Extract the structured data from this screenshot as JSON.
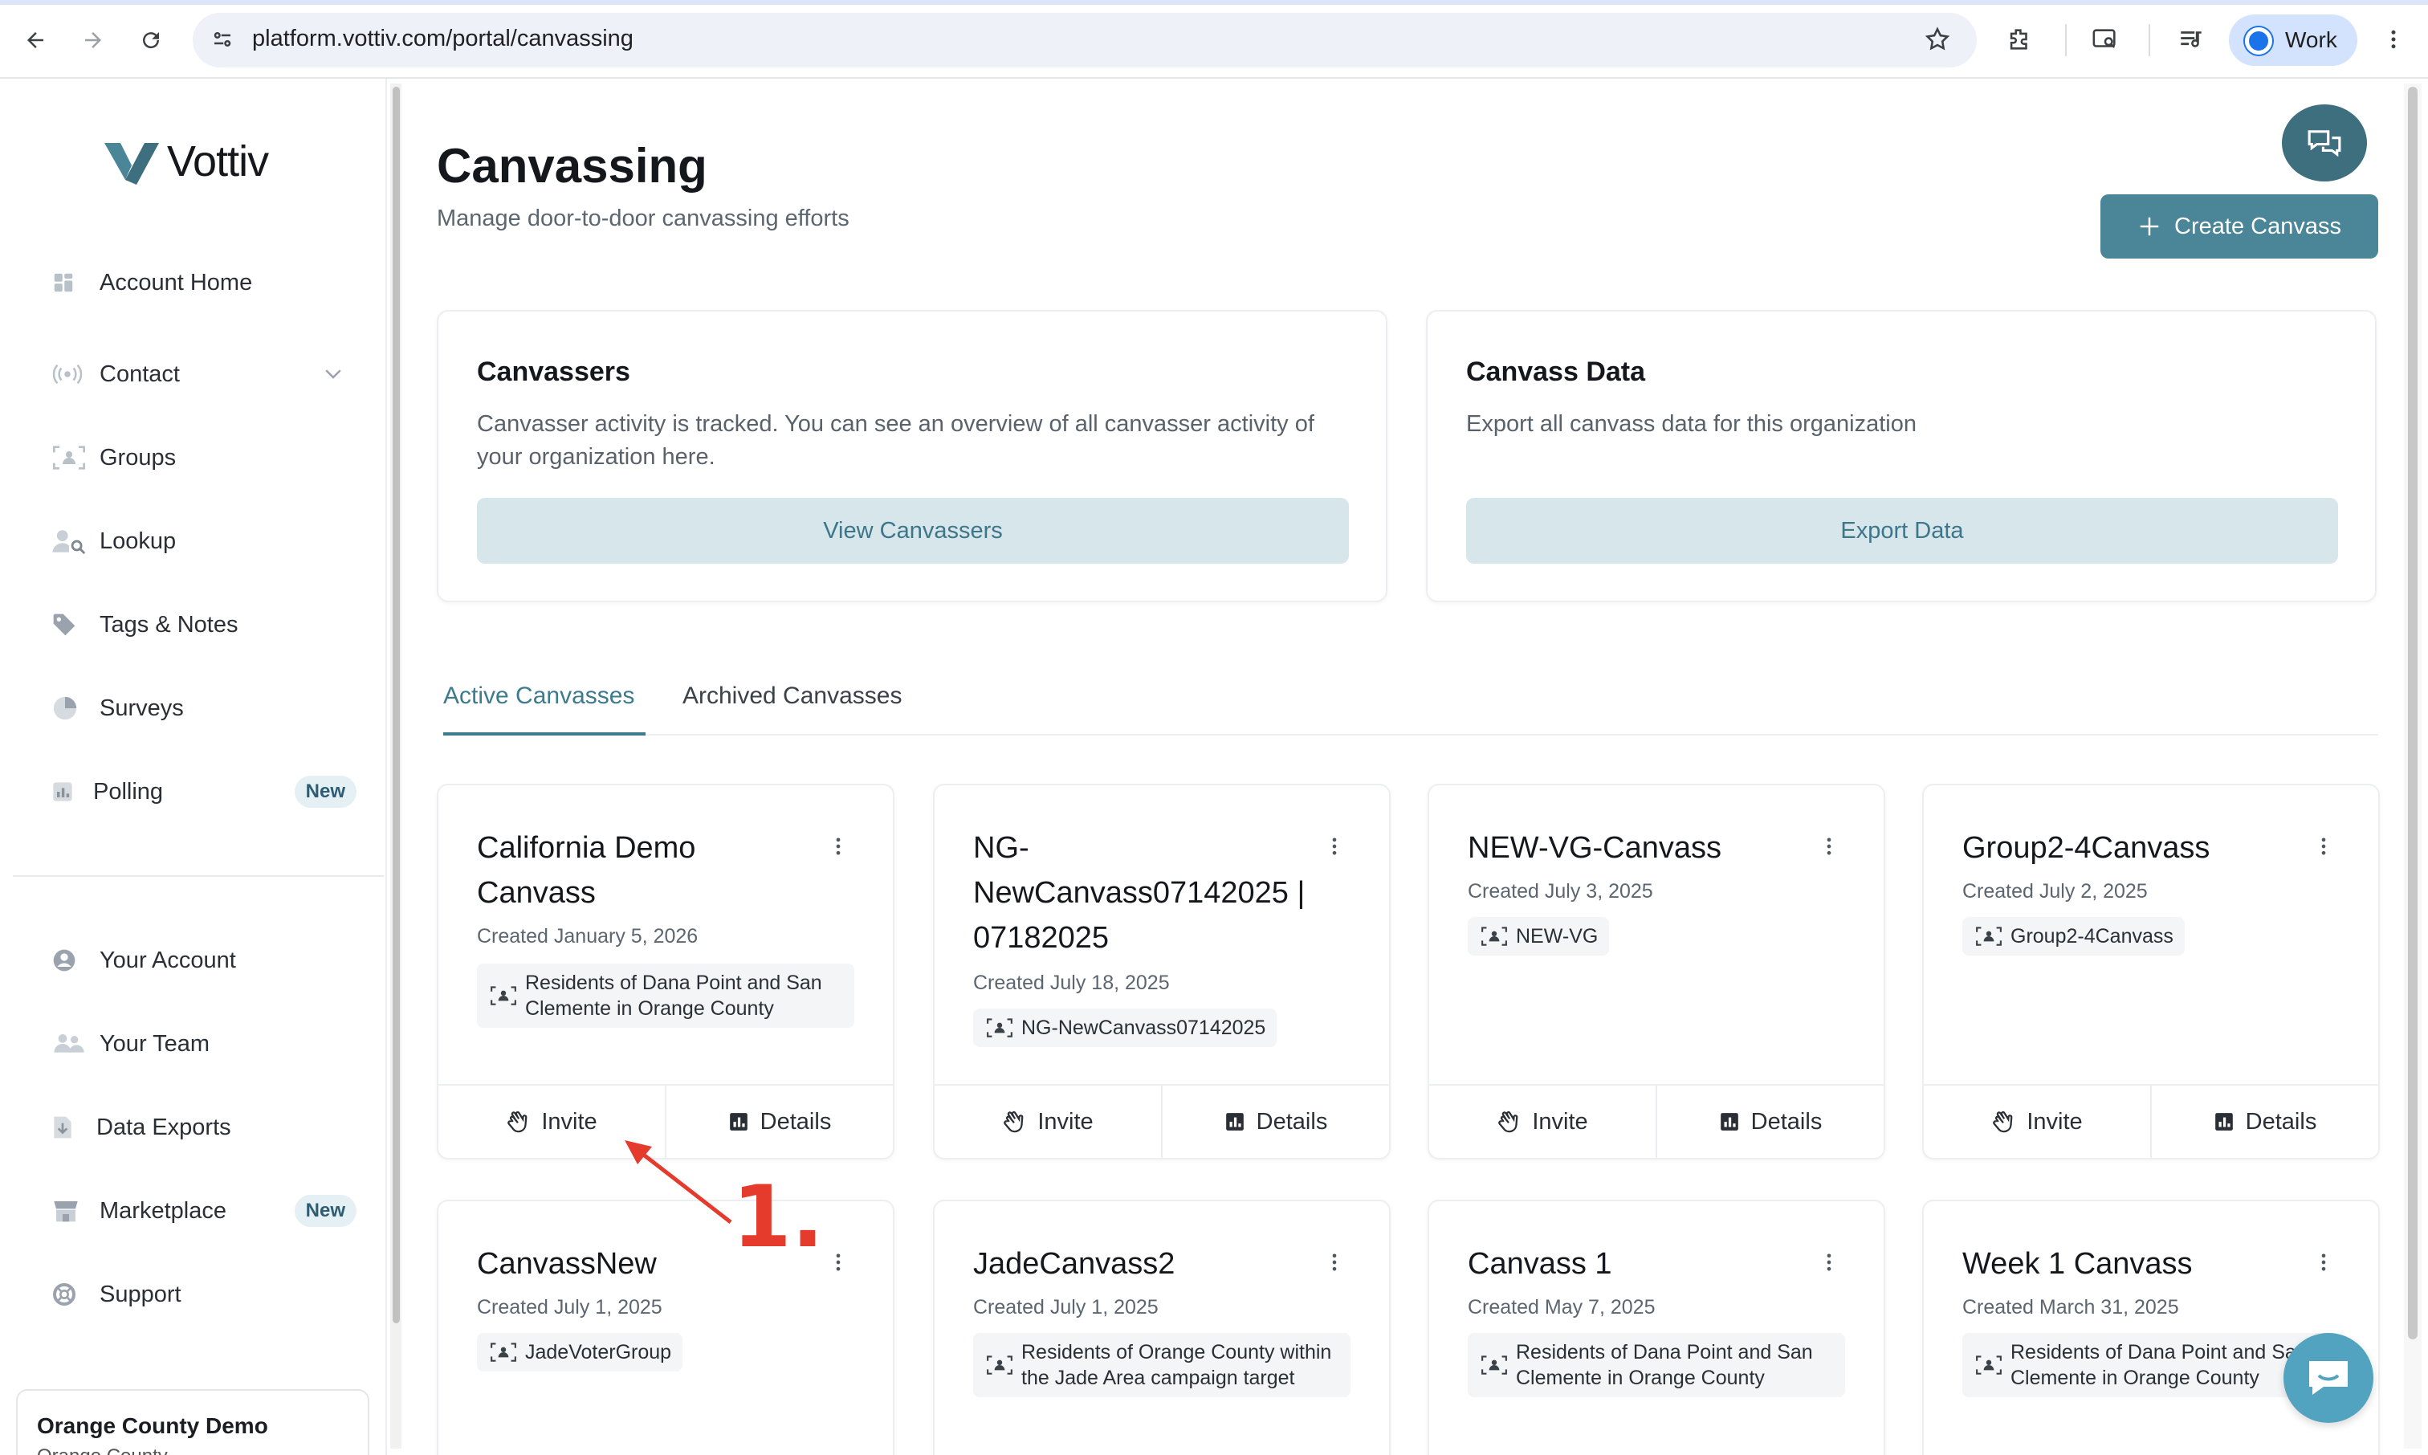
{
  "browser": {
    "url": "platform.vottiv.com/portal/canvassing",
    "profile_label": "Work"
  },
  "brand": {
    "name": "Vottiv",
    "accent": "#4a8598",
    "logo_color": "#3d7a8e"
  },
  "sidebar": {
    "items": [
      {
        "label": "Account Home",
        "icon": "grid-icon"
      },
      {
        "label": "Contact",
        "icon": "broadcast-icon"
      },
      {
        "label": "Groups",
        "icon": "group-icon"
      },
      {
        "label": "Lookup",
        "icon": "person-search-icon"
      },
      {
        "label": "Tags & Notes",
        "icon": "tag-icon"
      },
      {
        "label": "Surveys",
        "icon": "pie-icon"
      },
      {
        "label": "Polling",
        "icon": "bar-chart-icon",
        "badge": "New"
      }
    ],
    "bottom_items": [
      {
        "label": "Your Account",
        "icon": "user-circle-icon"
      },
      {
        "label": "Your Team",
        "icon": "team-icon"
      },
      {
        "label": "Data Exports",
        "icon": "file-download-icon"
      },
      {
        "label": "Marketplace",
        "icon": "store-icon",
        "badge": "New"
      },
      {
        "label": "Support",
        "icon": "lifebuoy-icon"
      }
    ],
    "org": {
      "name": "Orange County Demo",
      "sub": "Orange County"
    }
  },
  "page": {
    "title": "Canvassing",
    "subtitle": "Manage door-to-door canvassing efforts",
    "create_button": "Create Canvass"
  },
  "panels": [
    {
      "title": "Canvassers",
      "description": "Canvasser activity is tracked. You can see an overview of all canvasser activity of your organization here.",
      "button": "View Canvassers"
    },
    {
      "title": "Canvass Data",
      "description": "Export all canvass data for this organization",
      "button": "Export Data"
    }
  ],
  "tabs": {
    "active": "Active Canvasses",
    "archived": "Archived Canvasses"
  },
  "card_actions": {
    "invite": "Invite",
    "details": "Details"
  },
  "cards": [
    {
      "title": "California Demo Canvass",
      "created": "Created January 5, 2026",
      "group": "Residents of Dana Point and San Clemente in Orange County"
    },
    {
      "title": "NG-NewCanvass07142025 | 07182025",
      "created": "Created July 18, 2025",
      "group": "NG-NewCanvass07142025"
    },
    {
      "title": "NEW-VG-Canvass",
      "created": "Created July 3, 2025",
      "group": "NEW-VG"
    },
    {
      "title": "Group2-4Canvass",
      "created": "Created July 2, 2025",
      "group": "Group2-4Canvass"
    },
    {
      "title": "CanvassNew",
      "created": "Created July 1, 2025",
      "group": "JadeVoterGroup"
    },
    {
      "title": "JadeCanvass2",
      "created": "Created July 1, 2025",
      "group": "Residents of Orange County within the Jade Area campaign target"
    },
    {
      "title": "Canvass 1",
      "created": "Created May 7, 2025",
      "group": "Residents of Dana Point and San Clemente in Orange County"
    },
    {
      "title": "Week 1 Canvass",
      "created": "Created March 31, 2025",
      "group": "Residents of Dana Point and San Clemente in Orange County"
    }
  ],
  "annotation": {
    "label": "1.",
    "color": "#e53b2c"
  }
}
